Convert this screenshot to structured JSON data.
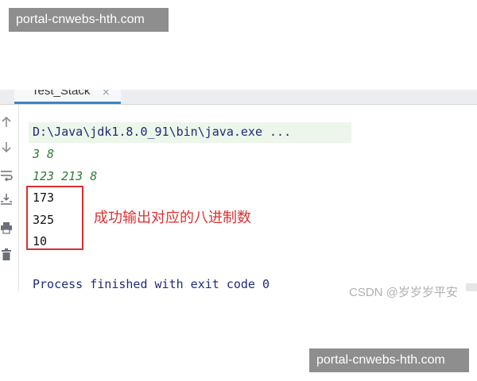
{
  "watermark": {
    "text": "portal-cnwebs-hth.com"
  },
  "run_tab": {
    "label": "Test_Stack",
    "close_glyph": "×"
  },
  "toolbar": {
    "icons": [
      "arrow-up-icon",
      "arrow-down-icon",
      "soft-wrap-icon",
      "sort-icon",
      "print-icon",
      "trash-icon"
    ]
  },
  "console": {
    "command": "D:\\Java\\jdk1.8.0_91\\bin\\java.exe ...",
    "input_lines": [
      "3 8",
      "123 213 8"
    ],
    "output_lines": [
      "173",
      "325",
      "10"
    ],
    "annotation": "成功输出对应的八进制数",
    "exit_message": "Process finished with exit code 0"
  },
  "csdn_watermark": "CSDN @岁岁岁平安",
  "colors": {
    "annotation_red": "#e03030",
    "input_green": "#2e7d32",
    "command_blue": "#1e2a78",
    "tab_underline": "#4083c9"
  }
}
